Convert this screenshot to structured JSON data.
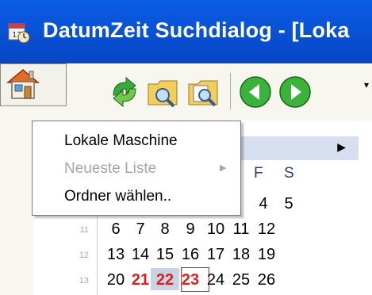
{
  "window": {
    "title": "DatumZeit Suchdialog -  [Loka"
  },
  "toolbar": {
    "buttons": [
      {
        "icon": "home-icon"
      },
      {
        "icon": "refresh-icon"
      },
      {
        "icon": "search-folder-icon"
      },
      {
        "icon": "search-document-icon"
      },
      {
        "icon": "back-arrow-icon"
      },
      {
        "icon": "forward-arrow-icon"
      }
    ]
  },
  "dropdown_menu": {
    "items": [
      {
        "label": "Lokale Maschine",
        "enabled": true
      },
      {
        "label": "Neueste Liste",
        "enabled": false,
        "has_submenu": true
      },
      {
        "label": "Ordner wählen..",
        "enabled": true
      }
    ]
  },
  "calendar": {
    "weekday_headers": [
      "F",
      "S"
    ],
    "rows": [
      {
        "week": "",
        "days": [
          "4",
          "5"
        ]
      },
      {
        "week": "11",
        "days": [
          "6",
          "7",
          "8",
          "9",
          "10",
          "11",
          "12"
        ]
      },
      {
        "week": "12",
        "days": [
          "13",
          "14",
          "15",
          "16",
          "17",
          "18",
          "19"
        ]
      },
      {
        "week": "13",
        "days": [
          "20",
          "21",
          "22",
          "23",
          "24",
          "25",
          "26"
        ]
      }
    ],
    "highlighted_red_days": [
      "21",
      "22",
      "23"
    ],
    "selected_day": "22",
    "today_day": "23",
    "colors": {
      "weekend_red": "#e02020",
      "selection_bg": "#c8d4e6",
      "header_bg": "#d6dff0",
      "titlebar_blue": "#0a53d8"
    }
  }
}
